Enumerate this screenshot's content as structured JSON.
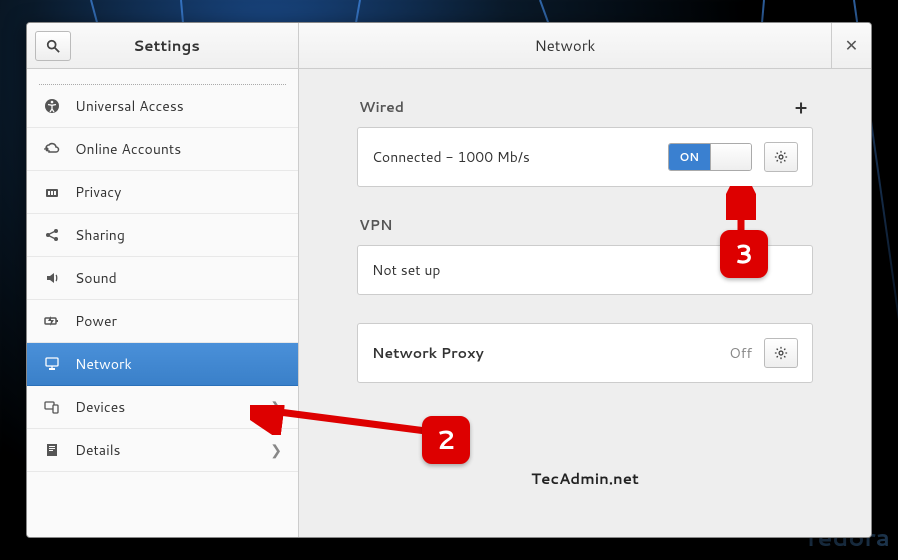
{
  "sidebar": {
    "title": "Settings",
    "items": [
      {
        "label": "Universal Access",
        "icon": "accessibility",
        "selected": false,
        "has_chevron": false
      },
      {
        "label": "Online Accounts",
        "icon": "cloud",
        "selected": false,
        "has_chevron": false
      },
      {
        "label": "Privacy",
        "icon": "privacy",
        "selected": false,
        "has_chevron": false
      },
      {
        "label": "Sharing",
        "icon": "share",
        "selected": false,
        "has_chevron": false
      },
      {
        "label": "Sound",
        "icon": "sound",
        "selected": false,
        "has_chevron": false
      },
      {
        "label": "Power",
        "icon": "power",
        "selected": false,
        "has_chevron": false
      },
      {
        "label": "Network",
        "icon": "network",
        "selected": true,
        "has_chevron": false
      },
      {
        "label": "Devices",
        "icon": "devices",
        "selected": false,
        "has_chevron": true
      },
      {
        "label": "Details",
        "icon": "details",
        "selected": false,
        "has_chevron": true
      }
    ]
  },
  "main": {
    "title": "Network",
    "wired": {
      "section_title": "Wired",
      "status": "Connected - 1000 Mb/s",
      "toggle_state": "ON"
    },
    "vpn": {
      "section_title": "VPN",
      "status": "Not set up"
    },
    "proxy": {
      "label": "Network Proxy",
      "status": "Off"
    }
  },
  "annotations": {
    "callout_2": "2",
    "callout_3": "3"
  },
  "watermark": "TecAdmin.net",
  "fedora": "fedora"
}
